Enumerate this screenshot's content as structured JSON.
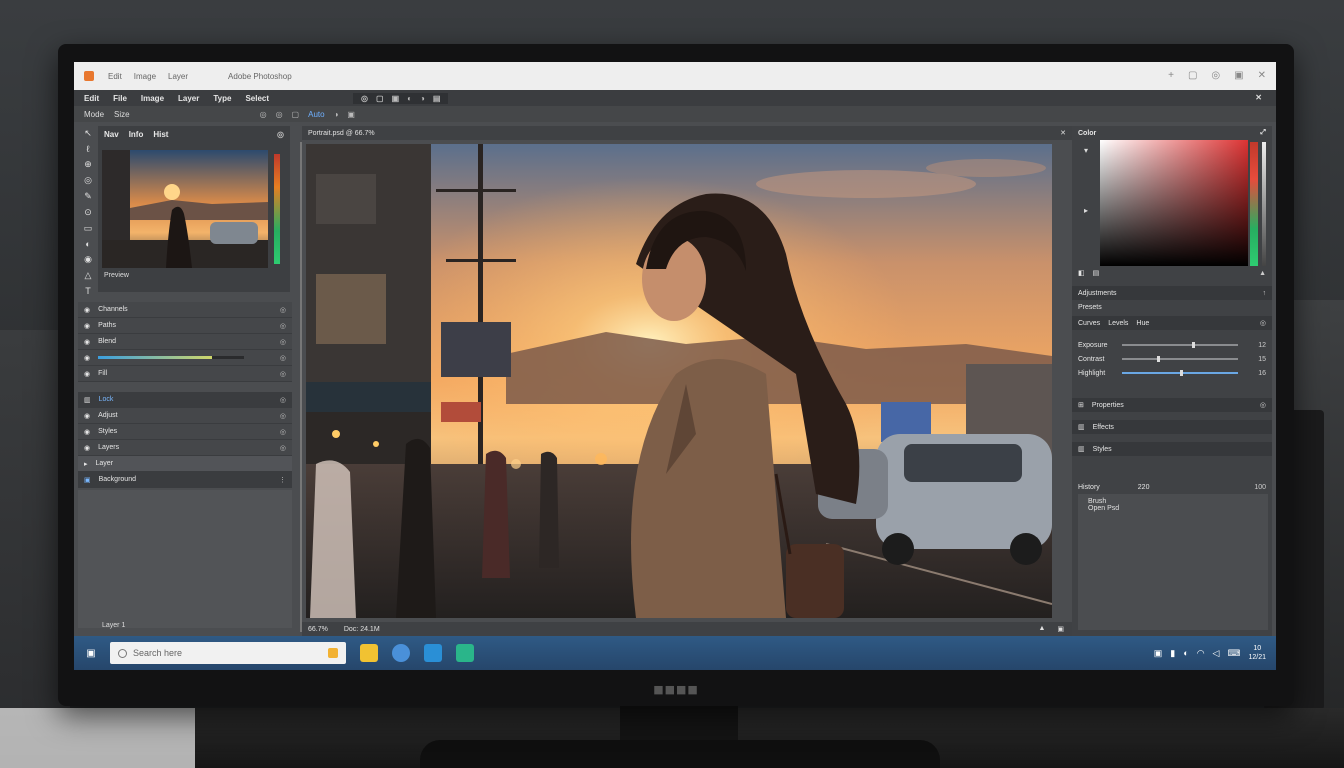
{
  "titlebar": {
    "menu": [
      "Edit",
      "Image",
      "Layer"
    ],
    "title": "Adobe Photoshop",
    "controls": [
      "+",
      "▢",
      "◎",
      "▣",
      "✕"
    ]
  },
  "menubar": {
    "items": [
      "Edit",
      "File",
      "Image",
      "Layer",
      "Type",
      "Select"
    ],
    "close": "✕"
  },
  "optbar": {
    "items": [
      "Mode",
      "Size"
    ],
    "blue": "Auto"
  },
  "navigator": {
    "tabs": [
      "Nav",
      "Info",
      "Hist"
    ],
    "footer": "Preview"
  },
  "left_rows": [
    {
      "label": "Channels",
      "end": "◎"
    },
    {
      "label": "Paths",
      "end": "◎"
    },
    {
      "label": "Blend",
      "end": "◎"
    },
    {
      "label": "",
      "end": "◎",
      "slider": true
    },
    {
      "label": "Fill",
      "end": "◎"
    }
  ],
  "left_rows2": [
    {
      "label": "Lock",
      "end": "◎"
    },
    {
      "label": "Adjust",
      "end": "◎"
    },
    {
      "label": "Styles",
      "end": "◎"
    },
    {
      "label": "Layers",
      "end": "◎"
    }
  ],
  "left_sel": "Layer",
  "left_blue": "Background",
  "left_foot": "Layer 1",
  "canvas": {
    "head": "Portrait.psd @ 66.7%",
    "foot_left": "66.7%",
    "foot_file": "Doc: 24.1M"
  },
  "right": {
    "color_title": "Color",
    "adjust_title": "Adjustments",
    "adjust_sub": "Presets",
    "tabs": [
      "Curves",
      "Levels",
      "Hue"
    ],
    "sliders": [
      {
        "label": "Exposure",
        "value": 0.6,
        "end": "12"
      },
      {
        "label": "Contrast",
        "value": 0.3,
        "end": "15"
      },
      {
        "label": "Highlight",
        "value": 0.5,
        "end": "16"
      }
    ],
    "row_a": "Properties",
    "row_b": "Effects",
    "row_c": "Styles",
    "history_title": "History",
    "history_count": "220",
    "history_end": "100",
    "history_note": "Brush",
    "history_note2": "Open Psd"
  },
  "taskbar": {
    "search_placeholder": "Search here",
    "time": "10",
    "date": "12/21"
  },
  "colors": {
    "accent": "#2f5a85",
    "panel": "#404245",
    "screen_bg": "#4b4d50"
  }
}
